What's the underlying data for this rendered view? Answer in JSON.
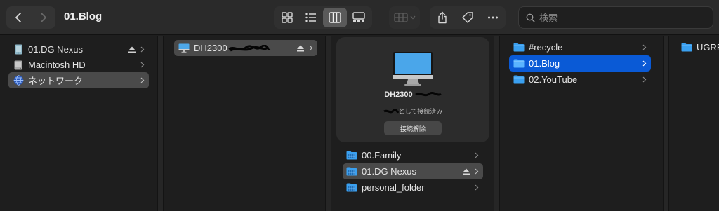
{
  "toolbar": {
    "title": "01.Blog",
    "search_placeholder": "検索",
    "view_modes": [
      "icon-view",
      "list-view",
      "column-view",
      "gallery-view"
    ],
    "active_view": "column-view"
  },
  "sidebar_column": {
    "items": [
      {
        "label": "01.DG Nexus",
        "icon": "external-drive-icon",
        "eject": true,
        "selected": false
      },
      {
        "label": "Macintosh HD",
        "icon": "internal-drive-icon",
        "eject": false,
        "selected": false
      },
      {
        "label": "ネットワーク",
        "icon": "network-globe-icon",
        "eject": false,
        "selected": true
      }
    ]
  },
  "network_column": {
    "items": [
      {
        "label": "DH2300",
        "icon": "monitor-icon",
        "eject": true,
        "selected": true
      }
    ]
  },
  "server_column": {
    "preview": {
      "name": "DH2300",
      "status": "として接続済み",
      "disconnect_label": "接続解除"
    },
    "shares": [
      {
        "label": "00.Family",
        "selected": false,
        "eject": false
      },
      {
        "label": "01.DG Nexus",
        "selected": true,
        "eject": true
      },
      {
        "label": "personal_folder",
        "selected": false,
        "eject": false
      }
    ]
  },
  "share_column": {
    "folders": [
      {
        "label": "#recycle",
        "selected": false
      },
      {
        "label": "01.Blog",
        "selected": true
      },
      {
        "label": "02.YouTube",
        "selected": false
      }
    ]
  },
  "next_column": {
    "folders": [
      {
        "label": "UGRE"
      }
    ]
  },
  "colors": {
    "accent_blue": "#0a5ad6",
    "folder_blue": "#3aa0f0"
  }
}
